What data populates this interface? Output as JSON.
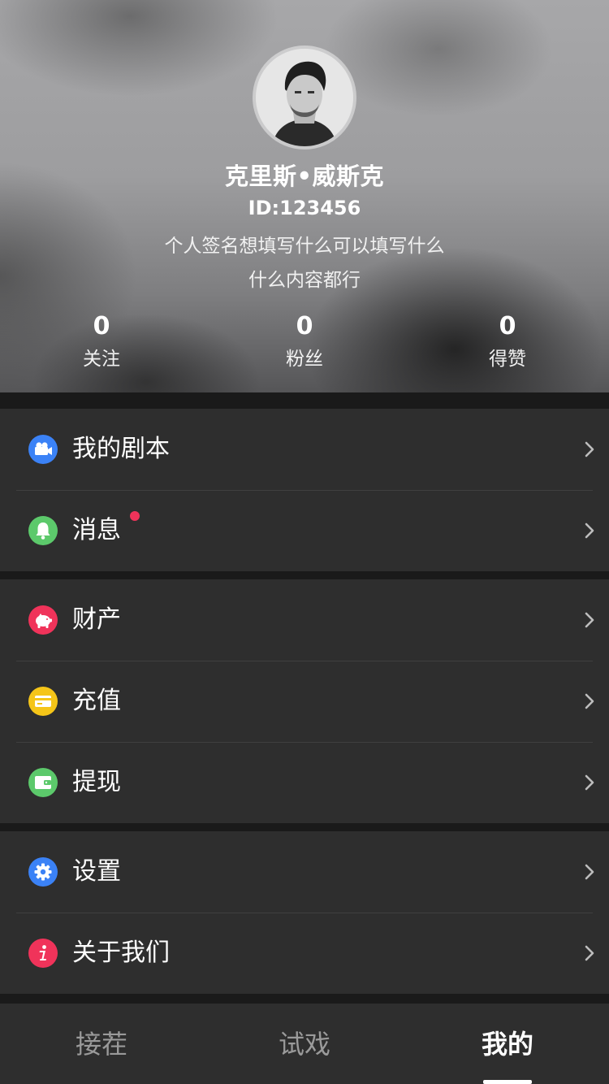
{
  "profile": {
    "name": "克里斯•威斯克",
    "id_text": "ID:123456",
    "signature_line1": "个人签名想填写什么可以填写什么",
    "signature_line2": "什么内容都行"
  },
  "stats": [
    {
      "value": "0",
      "label": "关注"
    },
    {
      "value": "0",
      "label": "粉丝"
    },
    {
      "value": "0",
      "label": "得赞"
    }
  ],
  "menu": {
    "scripts": {
      "label": "我的剧本",
      "icon": "video-camera-icon",
      "color": "#3b82f6"
    },
    "messages": {
      "label": "消息",
      "icon": "bell-icon",
      "color": "#5cc96b",
      "unread_dot_color": "#f0335a"
    },
    "assets": {
      "label": "财产",
      "icon": "piggy-bank-icon",
      "color": "#f0335a"
    },
    "recharge": {
      "label": "充值",
      "icon": "card-icon",
      "color": "#f5c518"
    },
    "withdraw": {
      "label": "提现",
      "icon": "wallet-icon",
      "color": "#5cc96b"
    },
    "settings": {
      "label": "设置",
      "icon": "gear-icon",
      "color": "#3b82f6"
    },
    "about": {
      "label": "关于我们",
      "icon": "info-icon",
      "color": "#f0335a"
    }
  },
  "tabs": [
    {
      "label": "接茬",
      "active": false
    },
    {
      "label": "试戏",
      "active": false
    },
    {
      "label": "我的",
      "active": true
    }
  ]
}
